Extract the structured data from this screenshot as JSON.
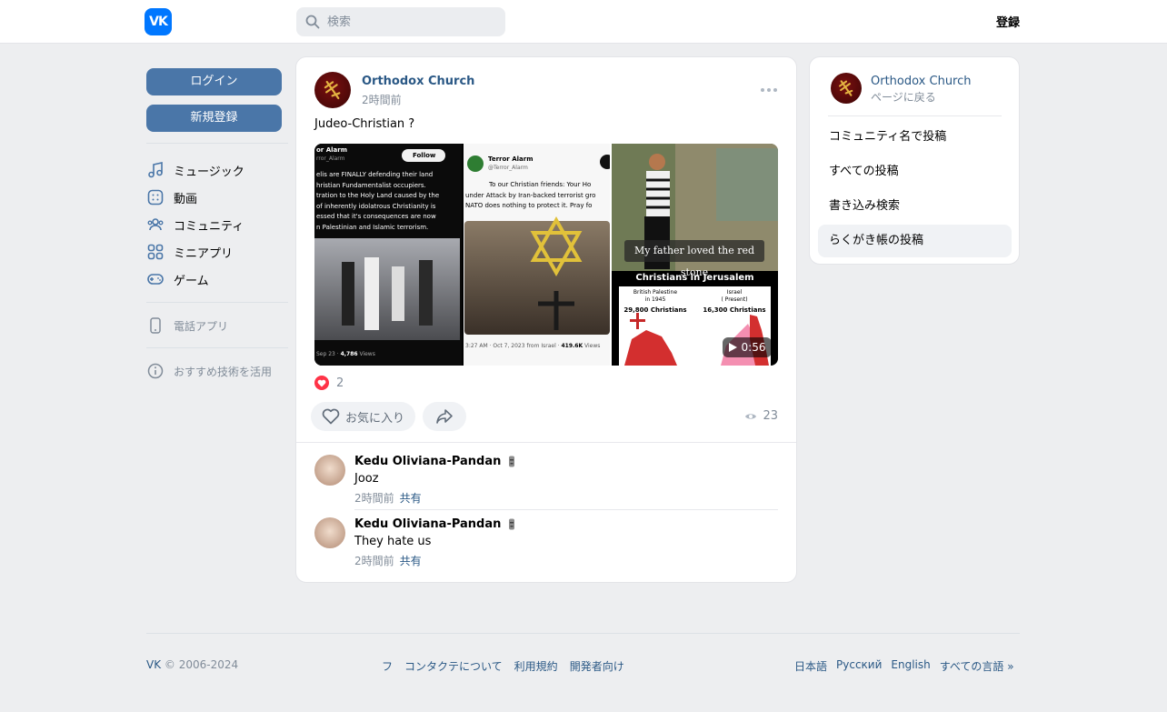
{
  "header": {
    "logo_text": "VK",
    "search_placeholder": "検索",
    "register_label": "登録"
  },
  "sidebar": {
    "login_label": "ログイン",
    "signup_label": "新規登録",
    "items": [
      {
        "label": "ミュージック",
        "icon": "music-icon"
      },
      {
        "label": "動画",
        "icon": "video-icon"
      },
      {
        "label": "コミュニティ",
        "icon": "community-icon"
      },
      {
        "label": "ミニアプリ",
        "icon": "mini-apps-icon"
      },
      {
        "label": "ゲーム",
        "icon": "gamepad-icon"
      }
    ],
    "phone_app_label": "電話アプリ",
    "recommend_label": "おすすめ技術を活用"
  },
  "post": {
    "author": "Orthodox Church",
    "time": "2時間前",
    "text": "Judeo-Christian ?",
    "photo1": {
      "left_tweet_author": "or Alarm",
      "left_tweet_handle": "rror_Alarm",
      "follow_label": "Follow",
      "left_tweet_lines": [
        "elis are FINALLY defending their land",
        "hristian Fundamentalist occupiers.",
        "tration to the Holy Land caused by the",
        "of inherently idolatrous Christianity is",
        "essed that it's consequences are now",
        "n Palestinian and Islamic terrorism."
      ],
      "left_tweet_footer_date": "Sep 23 · ",
      "left_tweet_footer_views": "4,786",
      "left_tweet_footer_views_label": " Views",
      "right_tweet_author": "Terror Alarm",
      "right_tweet_handle": "@Terror_Alarm",
      "right_tweet_lines": [
        "To our Christian friends: Your Ho",
        "under Attack by Iran-backed terrorist gro",
        "NATO does nothing to protect it. Pray fo"
      ],
      "right_tweet_footer_time": "3:27 AM · Oct 7, 2023 from Israel · ",
      "right_tweet_footer_views": "419.6K",
      "right_tweet_footer_views_label": " Views"
    },
    "photo2": {
      "caption": "My father loved the red stone",
      "map_title": "Christians in Jerusalem",
      "left_label_1": "British Palestine",
      "left_label_2": "in 1945",
      "left_count": "29,800 Christians",
      "right_label_1": "Israel",
      "right_label_2": "( Present)",
      "right_count": "16,300 Christians",
      "duration": "0:56"
    },
    "likes_count": "2",
    "favorite_label": "お気に入り",
    "views_count": "23"
  },
  "comments": [
    {
      "name": "Kedu Oliviana-Pandan",
      "text": "Jooz",
      "time": "2時間前",
      "share": "共有"
    },
    {
      "name": "Kedu Oliviana-Pandan",
      "text": "They hate us",
      "time": "2時間前",
      "share": "共有"
    }
  ],
  "right_panel": {
    "name": "Orthodox Church",
    "back_label": "ページに戻る",
    "items": [
      "コミュニティ名で投稿",
      "すべての投稿",
      "書き込み検索",
      "らくがき帳の投稿"
    ]
  },
  "footer": {
    "copy_vk": "VK",
    "copy_years": " © 2006-2024",
    "mid_links": [
      "フ",
      "コンタクテについて",
      "利用規約",
      "開発者向け"
    ],
    "lang_links": [
      "日本語",
      "Русский",
      "English",
      "すべての言語 »"
    ]
  },
  "colors": {
    "brand_blue": "#0077ff",
    "button_blue": "#4a76a8",
    "link": "#2a5885",
    "like_red": "#ff3347"
  }
}
